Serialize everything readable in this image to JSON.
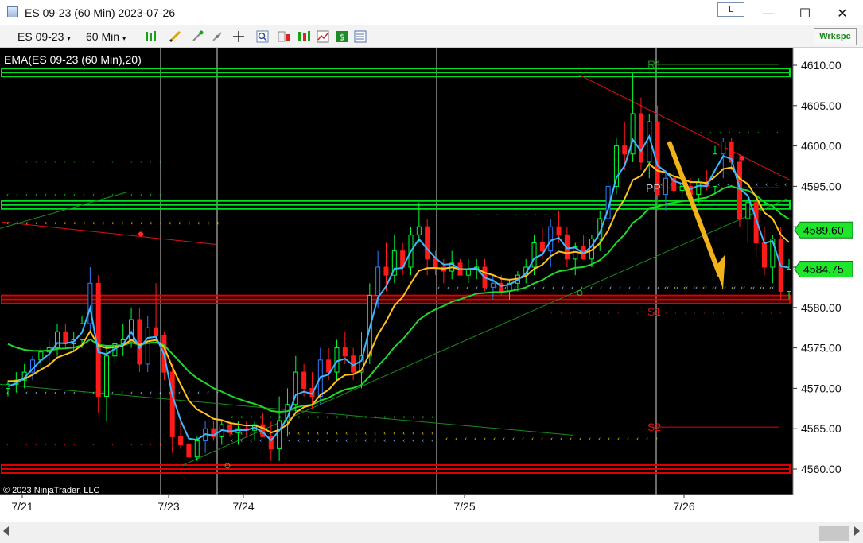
{
  "window": {
    "title": "ES 09-23 (60 Min)  2023-07-26",
    "layout_label": "L",
    "minimize_glyph": "—",
    "maximize_glyph": "☐",
    "close_glyph": "✕"
  },
  "toolbar": {
    "instrument": "ES 09-23",
    "interval": "60 Min",
    "workspace_label": "Wrkspc",
    "icons": [
      "bar-type-icon",
      "drawing-tools-icon",
      "hotkeys-icon",
      "indicator-icon",
      "crosshair-icon",
      "zoom-icon",
      "properties-icon",
      "strategies-icon",
      "chart-trader-icon",
      "dollar-icon",
      "data-box-icon"
    ]
  },
  "chart": {
    "indicator_label": "EMA(ES 09-23 (60 Min),20)",
    "copyright": "© 2023 NinjaTrader, LLC",
    "price_labels": [
      "4610.00",
      "4605.00",
      "4600.00",
      "4595.00",
      "4590.00",
      "4585.00",
      "4580.00",
      "4575.00",
      "4570.00",
      "4565.00",
      "4560.00"
    ],
    "current_price_flags": [
      "4589.60",
      "4584.75"
    ],
    "date_labels": [
      "7/21",
      "7/23",
      "7/24",
      "7/25",
      "7/26"
    ],
    "pivot_labels": [
      "R1",
      "PP",
      "S1",
      "S2"
    ],
    "colors": {
      "background": "#000000",
      "bull_candle": "#00ff33",
      "bear_candle": "#ff1a1a",
      "blue_candle": "#2f7cff",
      "ema_fast": "#3fb6ff",
      "ema_mid": "#ffc21a",
      "ema_slow": "#1fd62a",
      "arrow": "#f2b21a",
      "resistance_band": "#00e020",
      "support_band": "#e00000"
    }
  },
  "chart_data": {
    "type": "candlestick",
    "title": "ES 09-23 (60 Min)",
    "ylim": [
      4557,
      4613
    ],
    "x_ticks": [
      "7/21",
      "7/23",
      "7/24",
      "7/25",
      "7/26"
    ],
    "candles": [
      [
        4570,
        4571,
        4569,
        4570.5
      ],
      [
        4570.5,
        4572,
        4569.5,
        4571
      ],
      [
        4571,
        4573,
        4570,
        4572
      ],
      [
        4572,
        4574,
        4571,
        4573.5
      ],
      [
        4573.5,
        4575,
        4572.5,
        4574.5
      ],
      [
        4574.5,
        4576,
        4573,
        4575
      ],
      [
        4575,
        4578,
        4574,
        4577
      ],
      [
        4577,
        4578,
        4575,
        4575.5
      ],
      [
        4575.5,
        4577,
        4574.5,
        4576
      ],
      [
        4576,
        4579,
        4575,
        4578
      ],
      [
        4578,
        4585,
        4577,
        4583
      ],
      [
        4583,
        4584,
        4567,
        4569
      ],
      [
        4569,
        4575,
        4566,
        4574
      ],
      [
        4574,
        4576,
        4573,
        4575.5
      ],
      [
        4575.5,
        4578,
        4574,
        4576
      ],
      [
        4576,
        4580,
        4575,
        4578.5
      ],
      [
        4578.5,
        4580,
        4572,
        4573
      ],
      [
        4573,
        4579,
        4572,
        4577.5
      ],
      [
        4577.5,
        4583,
        4576,
        4576.5
      ],
      [
        4576.5,
        4577,
        4571,
        4572
      ],
      [
        4572,
        4573,
        4562,
        4564
      ],
      [
        4564,
        4566,
        4562.5,
        4563
      ],
      [
        4563,
        4565,
        4561,
        4561.5
      ],
      [
        4561.5,
        4564,
        4561,
        4563.5
      ],
      [
        4563.5,
        4566,
        4562,
        4565
      ],
      [
        4565,
        4566,
        4563.5,
        4564
      ],
      [
        4564,
        4566,
        4563,
        4565.5
      ],
      [
        4565.5,
        4566,
        4564,
        4564.5
      ],
      [
        4564.5,
        4566,
        4563,
        4565
      ],
      [
        4565,
        4566,
        4564,
        4564.8
      ],
      [
        4564.8,
        4566,
        4563.5,
        4565.5
      ],
      [
        4565.5,
        4567,
        4564,
        4564
      ],
      [
        4564,
        4566,
        4561,
        4562.5
      ],
      [
        4562.5,
        4569,
        4561,
        4566
      ],
      [
        4566,
        4570,
        4564,
        4568
      ],
      [
        4568,
        4574,
        4567,
        4572
      ],
      [
        4572,
        4573,
        4569,
        4570
      ],
      [
        4570,
        4572,
        4567.5,
        4569
      ],
      [
        4569,
        4575,
        4568,
        4573.5
      ],
      [
        4573.5,
        4575,
        4571,
        4572
      ],
      [
        4572,
        4576,
        4571,
        4575
      ],
      [
        4575,
        4577,
        4573,
        4574
      ],
      [
        4574,
        4575,
        4571,
        4572
      ],
      [
        4572,
        4577,
        4570,
        4574
      ],
      [
        4574,
        4583,
        4573,
        4581.5
      ],
      [
        4581.5,
        4587,
        4580,
        4585
      ],
      [
        4585,
        4588,
        4582,
        4584
      ],
      [
        4584,
        4589,
        4583,
        4587
      ],
      [
        4587,
        4588,
        4584,
        4585
      ],
      [
        4585,
        4590,
        4584,
        4589
      ],
      [
        4589,
        4593,
        4588,
        4590
      ],
      [
        4590,
        4591,
        4584,
        4586
      ],
      [
        4586,
        4587,
        4584,
        4585
      ],
      [
        4585,
        4586,
        4583,
        4584.5
      ],
      [
        4584.5,
        4587,
        4583.5,
        4585.5
      ],
      [
        4585.5,
        4586,
        4584,
        4584
      ],
      [
        4584,
        4586,
        4583,
        4584.8
      ],
      [
        4584.8,
        4586,
        4583.5,
        4585
      ],
      [
        4585,
        4586,
        4582,
        4582.5
      ],
      [
        4582.5,
        4584,
        4581,
        4583
      ],
      [
        4583,
        4584,
        4581.5,
        4582
      ],
      [
        4582,
        4583.5,
        4581,
        4583
      ],
      [
        4583,
        4584.5,
        4582,
        4584
      ],
      [
        4584,
        4586,
        4583,
        4585
      ],
      [
        4585,
        4589,
        4584,
        4588
      ],
      [
        4588,
        4590,
        4586,
        4587
      ],
      [
        4587,
        4591,
        4585,
        4590
      ],
      [
        4590,
        4592,
        4588,
        4589
      ],
      [
        4589,
        4590,
        4585,
        4586
      ],
      [
        4586,
        4588,
        4584,
        4587.5
      ],
      [
        4587.5,
        4589,
        4586,
        4586
      ],
      [
        4586,
        4589,
        4585,
        4588.5
      ],
      [
        4588.5,
        4592,
        4587,
        4591
      ],
      [
        4591,
        4596,
        4590,
        4595
      ],
      [
        4595,
        4601,
        4594,
        4600
      ],
      [
        4600,
        4603,
        4597,
        4599
      ],
      [
        4599,
        4609,
        4598,
        4604
      ],
      [
        4604,
        4606,
        4597,
        4598
      ],
      [
        4598,
        4604,
        4596,
        4603
      ],
      [
        4603,
        4605,
        4592,
        4594
      ],
      [
        4594,
        4597,
        4592,
        4596
      ],
      [
        4596,
        4597,
        4594,
        4594.5
      ],
      [
        4594.5,
        4596,
        4593,
        4595
      ],
      [
        4595,
        4596,
        4593.5,
        4594
      ],
      [
        4594,
        4596,
        4593,
        4595.5
      ],
      [
        4595.5,
        4597,
        4594.5,
        4595
      ],
      [
        4595,
        4600,
        4594,
        4599
      ],
      [
        4599,
        4601,
        4596,
        4600.5
      ],
      [
        4600.5,
        4601,
        4597,
        4598
      ],
      [
        4598,
        4599,
        4590,
        4591
      ],
      [
        4591,
        4594,
        4588,
        4593
      ],
      [
        4593,
        4594,
        4586,
        4588
      ],
      [
        4588,
        4590,
        4584,
        4585
      ],
      [
        4585,
        4589,
        4583,
        4588.5
      ],
      [
        4588.5,
        4590,
        4581,
        4582
      ],
      [
        4582,
        4586,
        4581,
        4584.75
      ]
    ]
  }
}
